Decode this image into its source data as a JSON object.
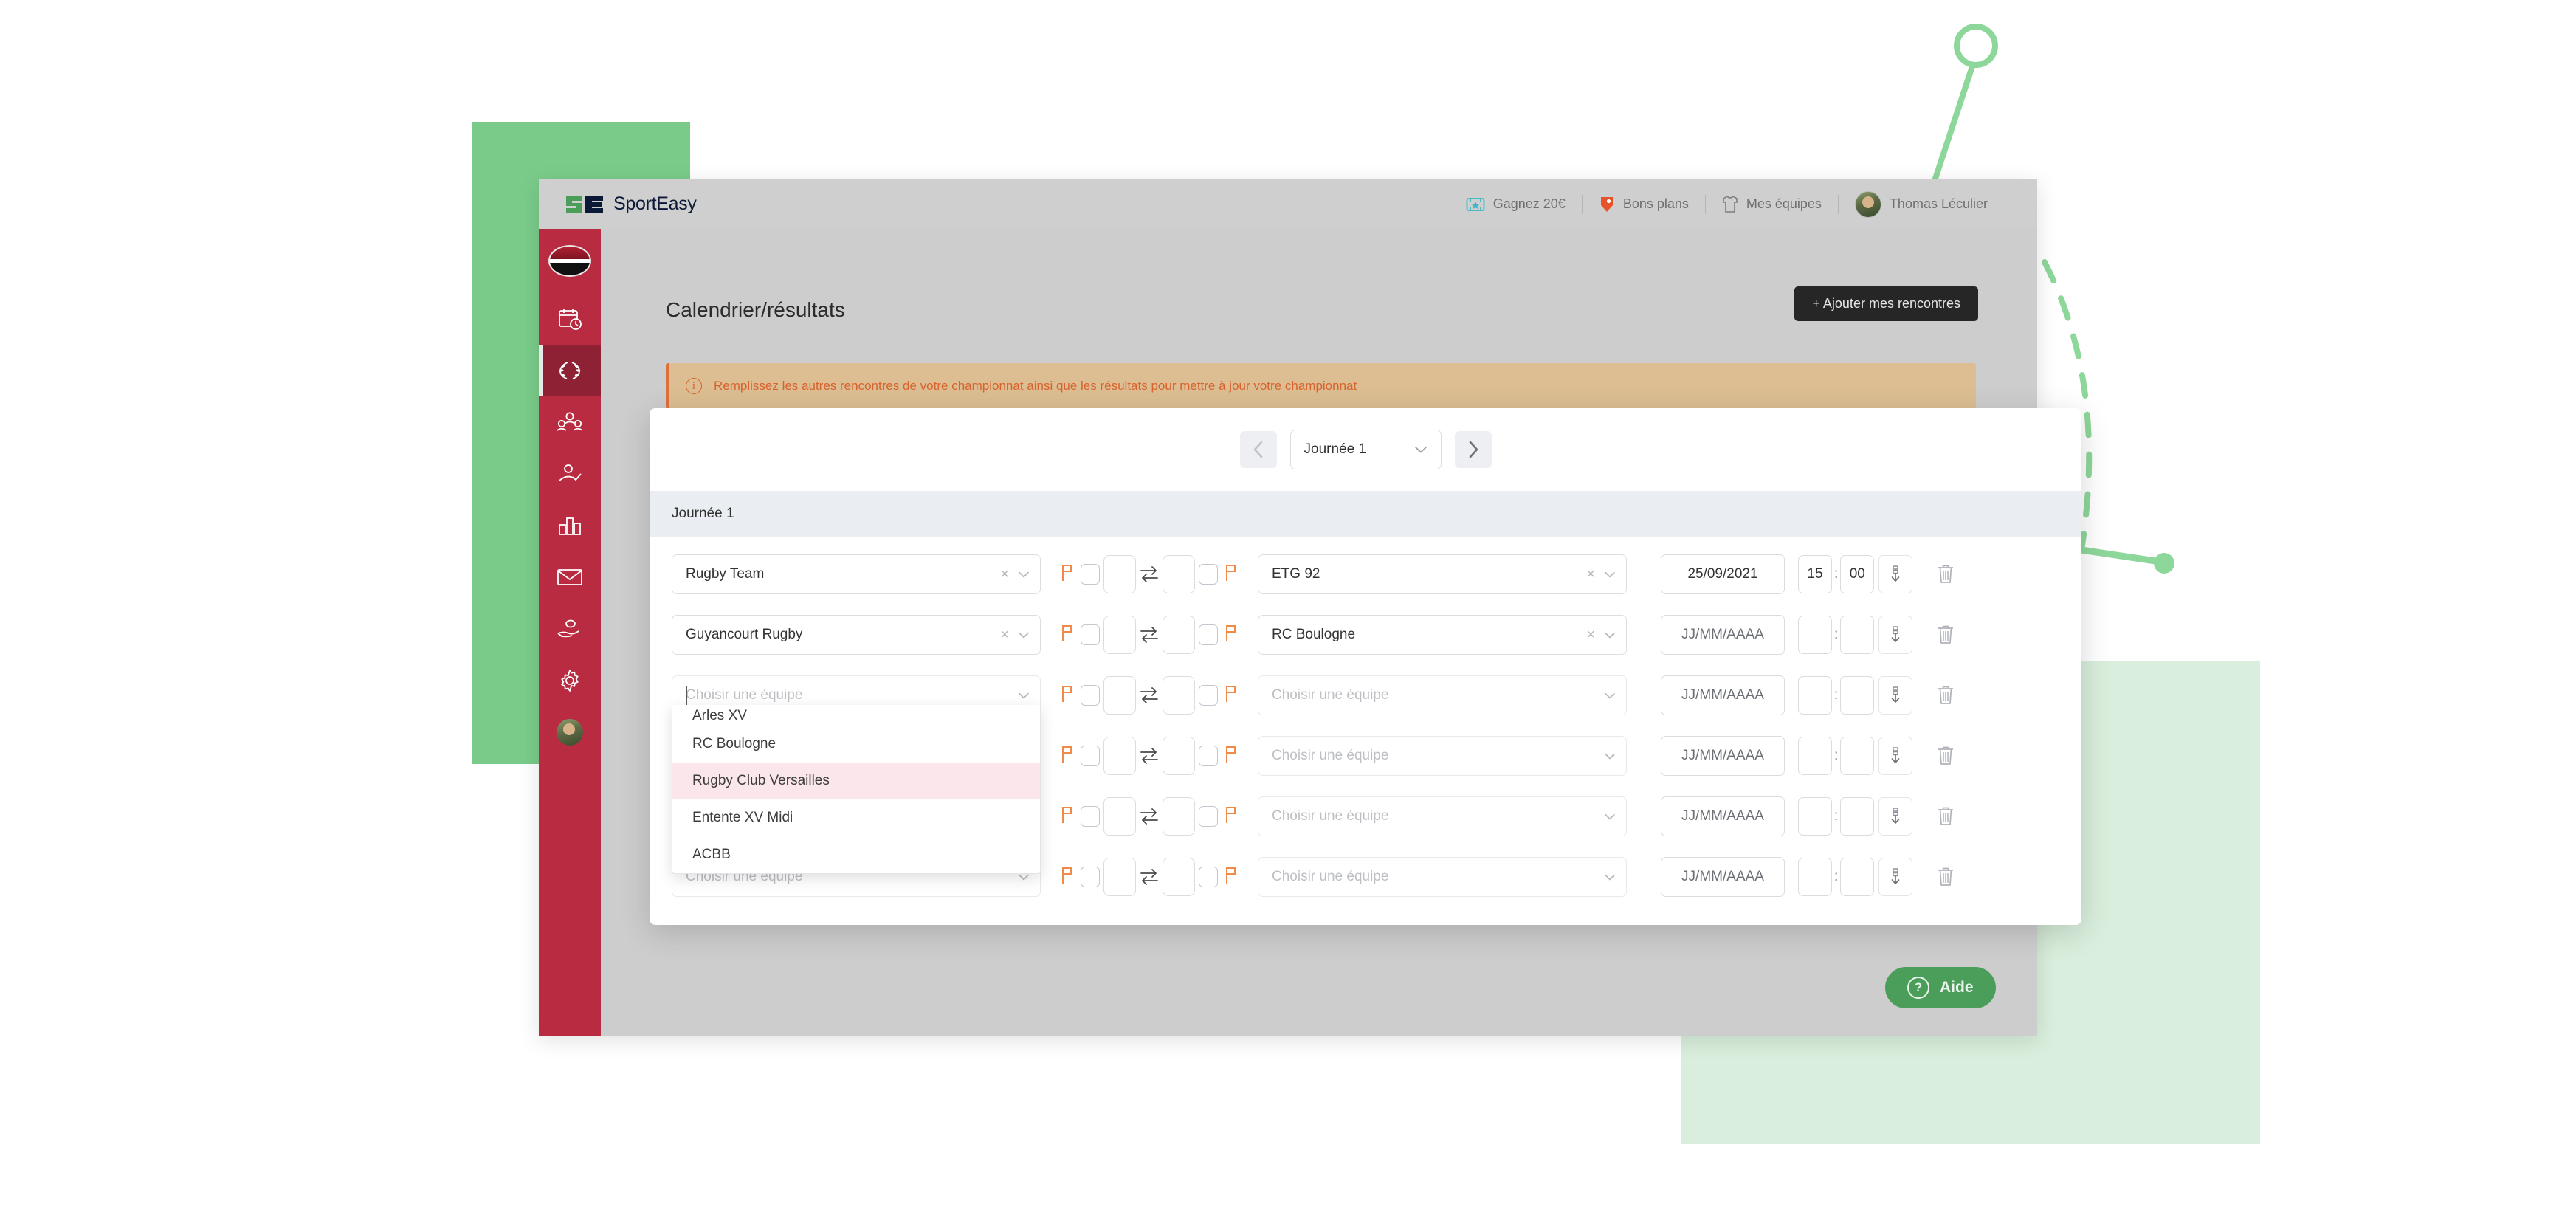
{
  "colors": {
    "brand_green": "#4B9E5A",
    "brand_navy": "#0B1836",
    "sidebar_red": "#B82B40",
    "sidebar_active": "#8E2133",
    "alert_bg": "#DCBE92",
    "alert_text": "#D9632E",
    "flag_orange": "#F08A48",
    "deco_green": "#7ACB8A",
    "deco_green_light": "#D9EEDC",
    "highlight_pink": "#FBE7EB"
  },
  "topbar": {
    "brand_name": "SportEasy",
    "items": [
      {
        "label": "Gagnez 20€",
        "icon": "ticket-icon"
      },
      {
        "label": "Bons plans",
        "icon": "tag-icon"
      },
      {
        "label": "Mes équipes",
        "icon": "jersey-icon"
      }
    ],
    "user_name": "Thomas Léculier"
  },
  "sidebar": {
    "items": [
      {
        "name": "team-logo",
        "icon": "team-logo-icon",
        "active": false
      },
      {
        "name": "calendar",
        "icon": "calendar-clock-icon",
        "active": false
      },
      {
        "name": "competitions",
        "icon": "laurel-wreath-icon",
        "active": true
      },
      {
        "name": "members",
        "icon": "group-icon",
        "active": false
      },
      {
        "name": "attendance",
        "icon": "person-check-icon",
        "active": false
      },
      {
        "name": "stats",
        "icon": "bar-chart-icon",
        "active": false
      },
      {
        "name": "messages",
        "icon": "envelope-icon",
        "active": false
      },
      {
        "name": "sponsors",
        "icon": "hand-ball-icon",
        "active": false
      },
      {
        "name": "settings",
        "icon": "gear-icon",
        "active": false
      },
      {
        "name": "profile",
        "icon": "avatar-icon",
        "active": false
      }
    ]
  },
  "page": {
    "title": "Calendrier/résultats",
    "add_button": "+ Ajouter mes rencontres",
    "alert": "Remplissez les autres rencontres de votre championnat ainsi que les résultats pour mettre à jour votre championnat"
  },
  "modal": {
    "matchday_select": "Journée 1",
    "prev_label": "‹",
    "next_label": "›",
    "section_title": "Journée 1",
    "team_placeholder": "Choisir une équipe",
    "date_placeholder": "JJ/MM/AAAA",
    "rows": [
      {
        "home": "Rugby Team",
        "away": "ETG 92",
        "date": "25/09/2021",
        "hour": "15",
        "minute": "00",
        "home_empty": false,
        "away_empty": false,
        "date_empty": false
      },
      {
        "home": "Guyancourt Rugby",
        "away": "RC Boulogne",
        "date": "",
        "hour": "",
        "minute": "",
        "home_empty": false,
        "away_empty": false,
        "date_empty": true
      },
      {
        "home": "",
        "away": "",
        "date": "",
        "hour": "",
        "minute": "",
        "home_empty": true,
        "away_empty": true,
        "date_empty": true
      },
      {
        "home": "",
        "away": "",
        "date": "",
        "hour": "",
        "minute": "",
        "home_empty": true,
        "away_empty": true,
        "date_empty": true
      },
      {
        "home": "",
        "away": "",
        "date": "",
        "hour": "",
        "minute": "",
        "home_empty": true,
        "away_empty": true,
        "date_empty": true
      },
      {
        "home": "",
        "away": "",
        "date": "",
        "hour": "",
        "minute": "",
        "home_empty": true,
        "away_empty": true,
        "date_empty": true
      }
    ],
    "dropdown": {
      "open_on_row": 2,
      "options": [
        {
          "label": "Arles XV",
          "highlighted": false,
          "clipped": true
        },
        {
          "label": "RC Boulogne",
          "highlighted": false,
          "clipped": false
        },
        {
          "label": "Rugby Club Versailles",
          "highlighted": true,
          "clipped": false
        },
        {
          "label": "Entente XV Midi",
          "highlighted": false,
          "clipped": false
        },
        {
          "label": "ACBB",
          "highlighted": false,
          "clipped": false
        }
      ]
    }
  },
  "help": {
    "label": "Aide",
    "icon": "question-circle-icon"
  }
}
